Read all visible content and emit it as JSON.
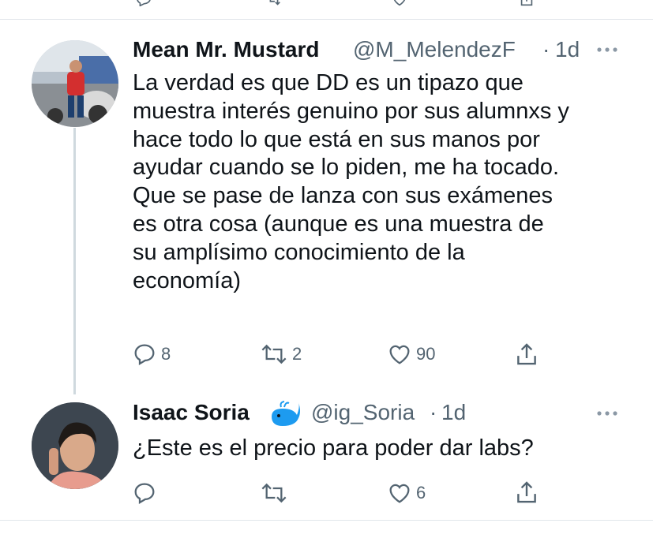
{
  "tweets": [
    {
      "display_name": "Mean Mr. Mustard",
      "handle": "@M_MelendezF",
      "separator": "·",
      "time": "1d",
      "text_lines": [
        "La verdad es que DD es un tipazo que",
        "muestra interés genuino por sus alumnxs y",
        "hace todo lo que está en sus manos por",
        "ayudar cuando se lo piden, me ha tocado.",
        "Que se pase de lanza con sus exámenes",
        "es otra cosa (aunque es una muestra de",
        "su amplísimo conocimiento de la",
        "economía)"
      ],
      "replies": "8",
      "retweets": "2",
      "likes": "90",
      "icons": {
        "reply": "reply-icon",
        "retweet": "retweet-icon",
        "like": "heart-icon",
        "share": "share-icon",
        "more": "more-dots-icon"
      }
    },
    {
      "display_name": "Isaac Soria",
      "name_emoji": "whale-emoji-icon",
      "handle": "@ig_Soria",
      "separator": "·",
      "time": "1d",
      "text_lines": [
        "¿Este es el precio para poder dar labs?"
      ],
      "replies": "",
      "retweets": "",
      "likes": "6",
      "icons": {
        "reply": "reply-icon",
        "retweet": "retweet-icon",
        "like": "heart-icon",
        "share": "share-icon",
        "more": "more-dots-icon"
      }
    }
  ],
  "colors": {
    "text": "#0f1419",
    "secondary": "#536471",
    "divider": "#e1e6ea",
    "whale": "#1d9bf0"
  }
}
